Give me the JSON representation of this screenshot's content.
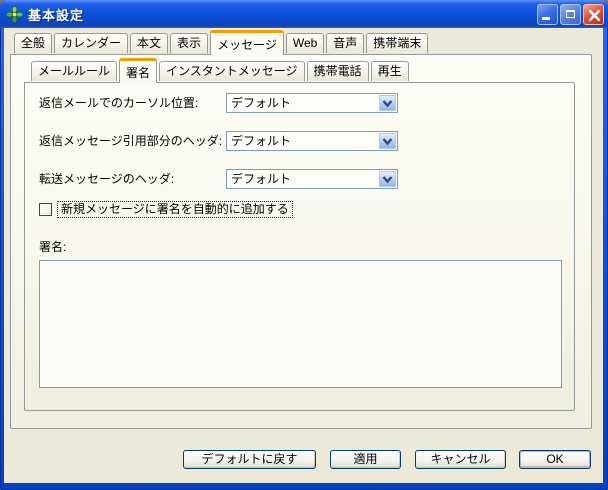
{
  "window": {
    "title": "基本設定"
  },
  "icons": {
    "app": "shuriken-app-icon",
    "minimize": "minimize-icon",
    "maximize": "maximize-icon",
    "close": "close-icon",
    "combo_arrow": "chevron-down-icon"
  },
  "tabs_primary": {
    "selected": "メッセージ",
    "items": [
      "全般",
      "カレンダー",
      "本文",
      "表示",
      "メッセージ",
      "Web",
      "音声",
      "携帯端末"
    ]
  },
  "tabs_secondary": {
    "selected": "署名",
    "items": [
      "メールルール",
      "署名",
      "インスタントメッセージ",
      "携帯電話",
      "再生"
    ]
  },
  "fields": [
    {
      "label": "返信メールでのカーソル位置:",
      "value": "デフォルト"
    },
    {
      "label": "返信メッセージ引用部分のヘッダ:",
      "value": "デフォルト"
    },
    {
      "label": "転送メッセージのヘッダ:",
      "value": "デフォルト"
    }
  ],
  "checkbox": {
    "label": "新規メッセージに署名を自動的に追加する",
    "checked": false
  },
  "signature": {
    "label": "署名:",
    "value": ""
  },
  "action_buttons": [
    "デフォルトに戻す",
    "適用",
    "キャンセル",
    "OK"
  ],
  "colors": {
    "titlebar_blue": "#0d52dd",
    "dialog_bg": "#ece9d8",
    "selected_tab_accent": "#f59d00",
    "tab_border": "#919b9c",
    "combo_border": "#7f9db9",
    "button_border": "#003c74"
  }
}
